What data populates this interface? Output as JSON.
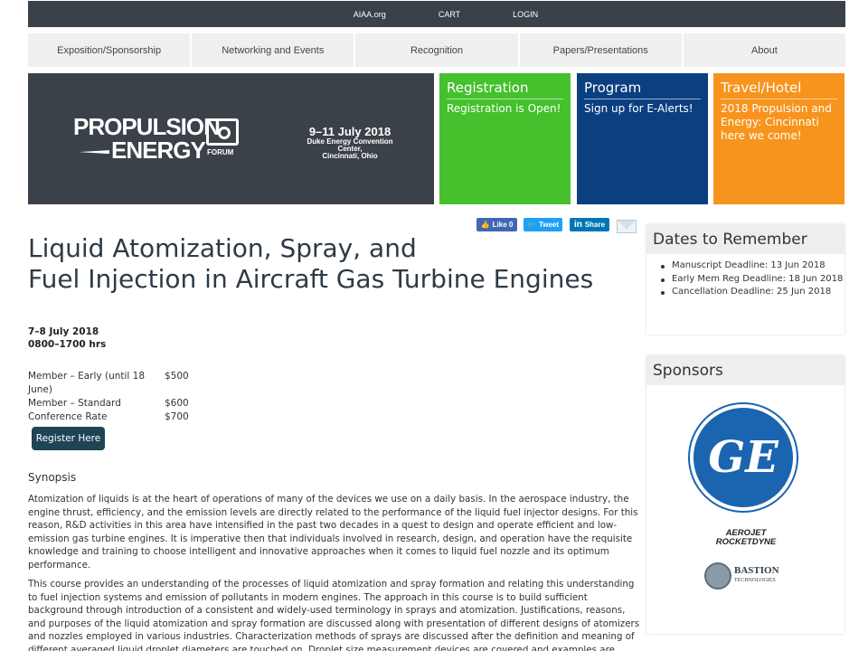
{
  "topbar": {
    "links": [
      "AIAA.org",
      "CART",
      "LOGIN"
    ]
  },
  "nav": {
    "items": [
      "Exposition/Sponsorship",
      "Networking and Events",
      "Recognition",
      "Papers/Presentations",
      "About"
    ]
  },
  "banner": {
    "logo_line1": "PROPULSION",
    "logo_line2": "ENERGY",
    "logo_sub": "FORUM",
    "date": "9–11 July 2018",
    "venue_line1": "Duke Energy Convention Center,",
    "venue_line2": "Cincinnati, Ohio"
  },
  "tiles": [
    {
      "heading": "Registration",
      "text": "Registration is Open!",
      "color": "#44c12c"
    },
    {
      "heading": "Program",
      "text": "Sign up for E-Alerts!",
      "color": "#0b3f80"
    },
    {
      "heading": "Travel/Hotel",
      "text": "2018 Propulsion and Energy: Cincinnati here we come!",
      "color": "#f7941d"
    }
  ],
  "share": {
    "facebook": "Like 0",
    "twitter": "Tweet",
    "linkedin": "Share"
  },
  "main": {
    "title_line1": "Liquid Atomization, Spray, and",
    "title_line2": "Fuel Injection in Aircraft Gas Turbine Engines",
    "date_line": "7–8 July 2018",
    "time_line": "0800–1700 hrs",
    "prices": [
      {
        "label": "Member – Early (until 18 June)",
        "value": "$500"
      },
      {
        "label": "Member – Standard",
        "value": "$600"
      },
      {
        "label": "Conference Rate",
        "value": "$700"
      }
    ],
    "register_button": "Register Here",
    "synopsis_heading": "Synopsis",
    "para1": "Atomization of liquids is at the heart of operations of many of the devices we use on a daily basis. In the aerospace industry, the engine thrust, efficiency, and the emission levels are directly related to the performance of the liquid fuel injector designs. For this reason, R&D activities in this area have intensified in the past two decades in a quest to design and operate efficient and low-emission gas turbine engines. It is imperative then that individuals involved in research, design, and operation have the requisite knowledge and training to choose intelligent and innovative approaches when it comes to liquid fuel nozzle and its optimum performance.",
    "para2": "This course provides an understanding of the processes of liquid atomization and spray formation and relating this understanding to fuel injection systems and emission of pollutants in modern engines. The approach in this course is to build sufficient background through introduction of a consistent and widely-used terminology in sprays and atomization. Justifications, reasons, and purposes of the liquid atomization and spray formation are discussed along with presentation of different designs of atomizers and nozzles employed in various industries. Characterization methods of sprays are discussed after the definition and meaning of different averaged liquid droplet diameters are touched on. Droplet size measurement devices are covered and examples are shown."
  },
  "sidebar": {
    "dates_heading": "Dates to Remember",
    "dates": [
      "Manuscript Deadline: 13 Jun 2018",
      "Early Mem Reg Deadline: 18 Jun 2018",
      "Cancellation Deadline: 25 Jun 2018"
    ],
    "sponsors_heading": "Sponsors",
    "sponsor_ge": "GE",
    "sponsor_aerojet_1": "AEROJET",
    "sponsor_aerojet_2": "ROCKETDYNE",
    "sponsor_bastion_1": "BASTION",
    "sponsor_bastion_2": "TECHNOLOGIES"
  }
}
